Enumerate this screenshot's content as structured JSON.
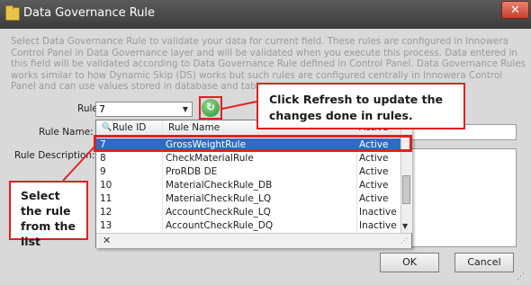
{
  "window": {
    "title": "Data Governance Rule",
    "close_label": "✕"
  },
  "description": "Select Data Governance Rule to validate your data for current field. These rules are configured in Innowera Control Panel in Data Governance layer and will be validated when you execute this process. Data entered in this field will be validated according to Data Governance Rule defined in Control Panel. Data Governance Rules works similar to how Dynamic Skip (DS) works but such rules are configured centrally in Innowera Control Panel and can use values stored in database and table.",
  "form": {
    "rule_id_label": "Rule ID:",
    "rule_id_value": "7",
    "rule_name_label": "Rule Name:",
    "rule_desc_label": "Rule Description:"
  },
  "grid": {
    "headers": [
      "Rule ID",
      "Rule Name",
      "Active"
    ],
    "rows": [
      {
        "id": "7",
        "name": "GrossWeightRule",
        "active": "Active"
      },
      {
        "id": "8",
        "name": "CheckMaterialRule",
        "active": "Active"
      },
      {
        "id": "9",
        "name": "ProRDB DE",
        "active": "Active"
      },
      {
        "id": "10",
        "name": "MaterialCheckRule_DB",
        "active": "Active"
      },
      {
        "id": "11",
        "name": "MaterialCheckRule_LQ",
        "active": "Active"
      },
      {
        "id": "12",
        "name": "AccountCheckRule_LQ",
        "active": "Inactive"
      },
      {
        "id": "13",
        "name": "AccountCheckRule_DQ",
        "active": "Inactive"
      }
    ],
    "selected_index": 0,
    "close_label": "✕"
  },
  "buttons": {
    "ok": "OK",
    "cancel": "Cancel"
  },
  "callouts": {
    "refresh": "Click Refresh to update the changes done in rules.",
    "select": "Select the rule from the list"
  },
  "icons": {
    "title": "folder-icon",
    "refresh": "refresh-icon",
    "search": "binoculars-icon"
  },
  "colors": {
    "callout_border": "#e02020",
    "selection": "#316ac5",
    "title_bar": "#4a4a4a"
  }
}
